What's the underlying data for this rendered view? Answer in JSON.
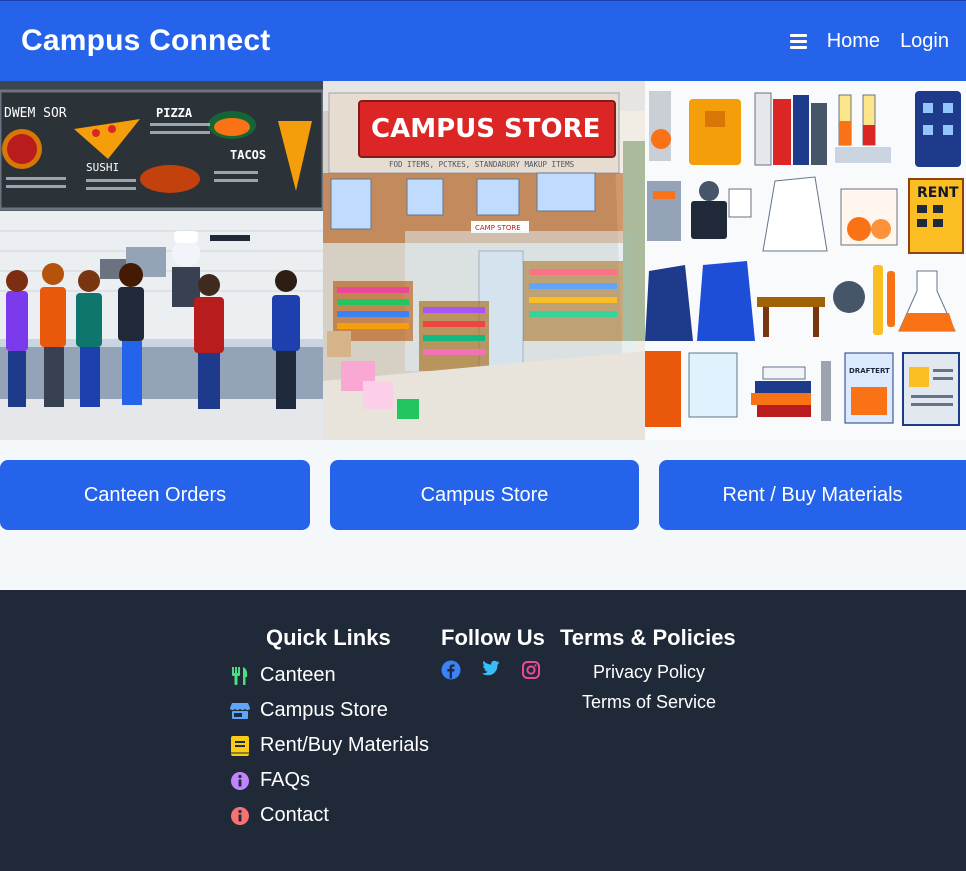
{
  "header": {
    "brand": "Campus Connect",
    "nav": {
      "menu_icon": "hamburger-icon",
      "home": "Home",
      "login": "Login"
    }
  },
  "hero": {
    "panels": [
      {
        "name": "canteen-illustration",
        "menu_text": {
          "left_heading": "DWEM SOR",
          "pizza": "PIZZA",
          "sushi": "SUSHI",
          "tacos": "TACOS"
        }
      },
      {
        "name": "campus-store-illustration",
        "sign": "CAMPUS STORE",
        "subtitle": "FOD ITEMS, PCTKES, STANDARURY MAKUP ITEMS",
        "door_sign": "CAMP STORE"
      },
      {
        "name": "materials-illustration",
        "rent_sign": "RENT",
        "draft_label": "DRAFTERT"
      }
    ]
  },
  "actions": {
    "canteen": "Canteen Orders",
    "store": "Campus Store",
    "materials": "Rent / Buy Materials"
  },
  "footer": {
    "quick_links": {
      "title": "Quick Links",
      "items": [
        {
          "label": "Canteen",
          "icon": "utensils-icon",
          "color": "#4ade80"
        },
        {
          "label": "Campus Store",
          "icon": "store-icon",
          "color": "#60a5fa"
        },
        {
          "label": "Rent/Buy Materials",
          "icon": "book-icon",
          "color": "#facc15"
        },
        {
          "label": "FAQs",
          "icon": "info-circle-icon",
          "color": "#c084fc"
        },
        {
          "label": "Contact",
          "icon": "info-circle-icon",
          "color": "#f87171"
        }
      ]
    },
    "follow": {
      "title": "Follow Us",
      "icons": [
        {
          "name": "facebook-icon",
          "color": "#3b82f6"
        },
        {
          "name": "twitter-icon",
          "color": "#38bdf8"
        },
        {
          "name": "instagram-icon",
          "color": "#ec4899"
        }
      ]
    },
    "policies": {
      "title": "Terms & Policies",
      "privacy": "Privacy Policy",
      "terms": "Terms of Service"
    }
  },
  "colors": {
    "primary": "#2563eb",
    "footer_bg": "#1f2937",
    "page_bg": "#f5f8fb"
  }
}
